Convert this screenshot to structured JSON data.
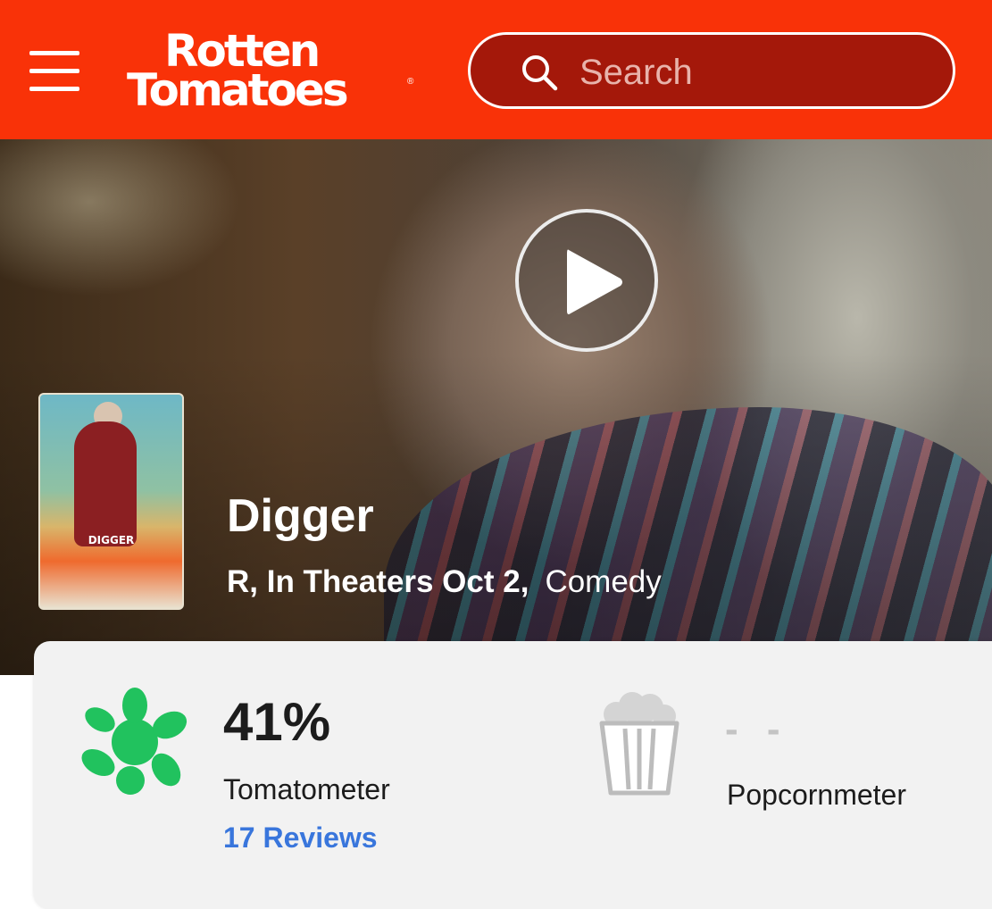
{
  "header": {
    "logo_line1": "Rotten",
    "logo_line2": "Tomatoes",
    "search_placeholder": "Search"
  },
  "hero": {
    "title": "Digger",
    "rating_release": "R, In Theaters Oct 2,",
    "genre": "Comedy",
    "poster_title": "DIGGER"
  },
  "scores": {
    "tomatometer_value": "41%",
    "tomatometer_label": "Tomatometer",
    "reviews_link": "17 Reviews",
    "popcornmeter_value": "- -",
    "popcornmeter_label": "Popcornmeter"
  },
  "colors": {
    "brand_red": "#f93208",
    "search_bg": "#a4180a",
    "splat_green": "#21c25e",
    "link_blue": "#3976dc",
    "popcorn_gray": "#c4c4c4"
  },
  "icons": {
    "menu": "hamburger-icon",
    "search": "search-icon",
    "play": "play-icon",
    "tomatometer": "green-splat-icon",
    "popcornmeter": "popcorn-bucket-icon"
  }
}
